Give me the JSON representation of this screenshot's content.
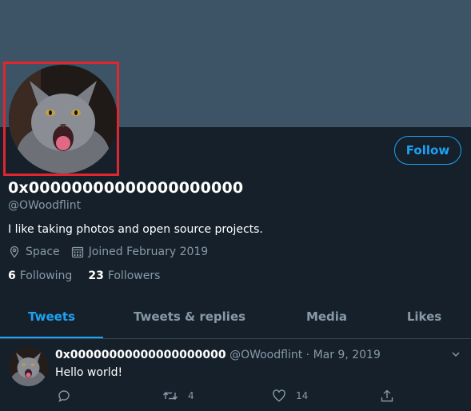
{
  "profile": {
    "display_name": "0x00000000000000000000",
    "handle": "@OWoodflint",
    "bio": "I like taking photos and open source projects.",
    "location": "Space",
    "joined": "Joined February 2019",
    "following_count": "6",
    "following_label": "Following",
    "followers_count": "23",
    "followers_label": "Followers",
    "follow_button": "Follow"
  },
  "tabs": [
    {
      "label": "Tweets",
      "active": true
    },
    {
      "label": "Tweets & replies",
      "active": false
    },
    {
      "label": "Media",
      "active": false
    },
    {
      "label": "Likes",
      "active": false
    }
  ],
  "tweet": {
    "name": "0x00000000000000000000",
    "handle": "@OWoodflint",
    "separator": "·",
    "date": "Mar 9, 2019",
    "text": "Hello world!",
    "retweets": "4",
    "likes": "14"
  },
  "colors": {
    "background": "#15202b",
    "banner": "#3d5466",
    "accent": "#1da1f2",
    "muted": "#8899a6",
    "highlight_box": "#e0262f"
  },
  "icons": [
    "location-icon",
    "calendar-icon",
    "reply-icon",
    "retweet-icon",
    "like-icon",
    "share-icon",
    "chevron-down-icon"
  ]
}
